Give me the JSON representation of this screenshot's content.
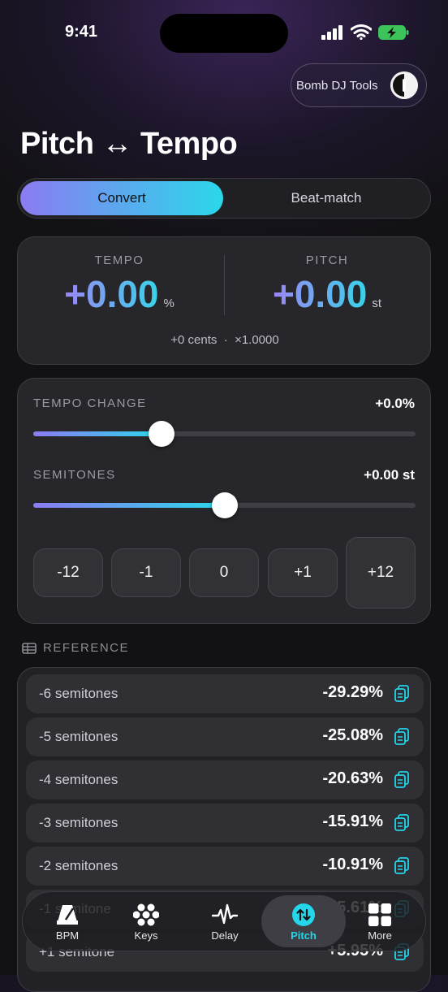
{
  "status_bar": {
    "time": "9:41"
  },
  "header": {
    "brand": "Bomb DJ Tools",
    "title": "Pitch ↔ Tempo"
  },
  "mode_tabs": [
    {
      "label": "Convert",
      "active": true
    },
    {
      "label": "Beat-match",
      "active": false
    }
  ],
  "readout": {
    "tempo": {
      "label": "TEMPO",
      "value": "+0.00",
      "unit": "%"
    },
    "pitch": {
      "label": "PITCH",
      "value": "+0.00",
      "unit": "st"
    },
    "footer": "+0 cents  ·  ×1.0000"
  },
  "controls": {
    "tempo_change": {
      "label": "TEMPO CHANGE",
      "value_text": "+0.0%",
      "level": 0.335
    },
    "semitones": {
      "label": "SEMITONES",
      "value_text": "+0.00 st",
      "level": 0.5
    },
    "steps": [
      "-12",
      "-1",
      "0",
      "+1",
      "+12"
    ]
  },
  "reference": {
    "heading": "REFERENCE",
    "rows": [
      {
        "label": "-6 semitones",
        "value": "-29.29%"
      },
      {
        "label": "-5 semitones",
        "value": "-25.08%"
      },
      {
        "label": "-4 semitones",
        "value": "-20.63%"
      },
      {
        "label": "-3 semitones",
        "value": "-15.91%"
      },
      {
        "label": "-2 semitones",
        "value": "-10.91%"
      },
      {
        "label": "-1 semitone",
        "value": "-5.61%"
      },
      {
        "label": "+1 semitone",
        "value": "+5.95%"
      }
    ]
  },
  "tabbar": [
    {
      "label": "BPM",
      "icon": "metronome-icon"
    },
    {
      "label": "Keys",
      "icon": "keys-grid-icon"
    },
    {
      "label": "Delay",
      "icon": "waveform-icon"
    },
    {
      "label": "Pitch",
      "icon": "pitch-arrows-icon",
      "active": true
    },
    {
      "label": "More",
      "icon": "more-grid-icon"
    }
  ],
  "colors": {
    "accent_start": "#8b7bf2",
    "accent_end": "#2ad8ea",
    "background": "#121214",
    "card": "#27272b"
  }
}
